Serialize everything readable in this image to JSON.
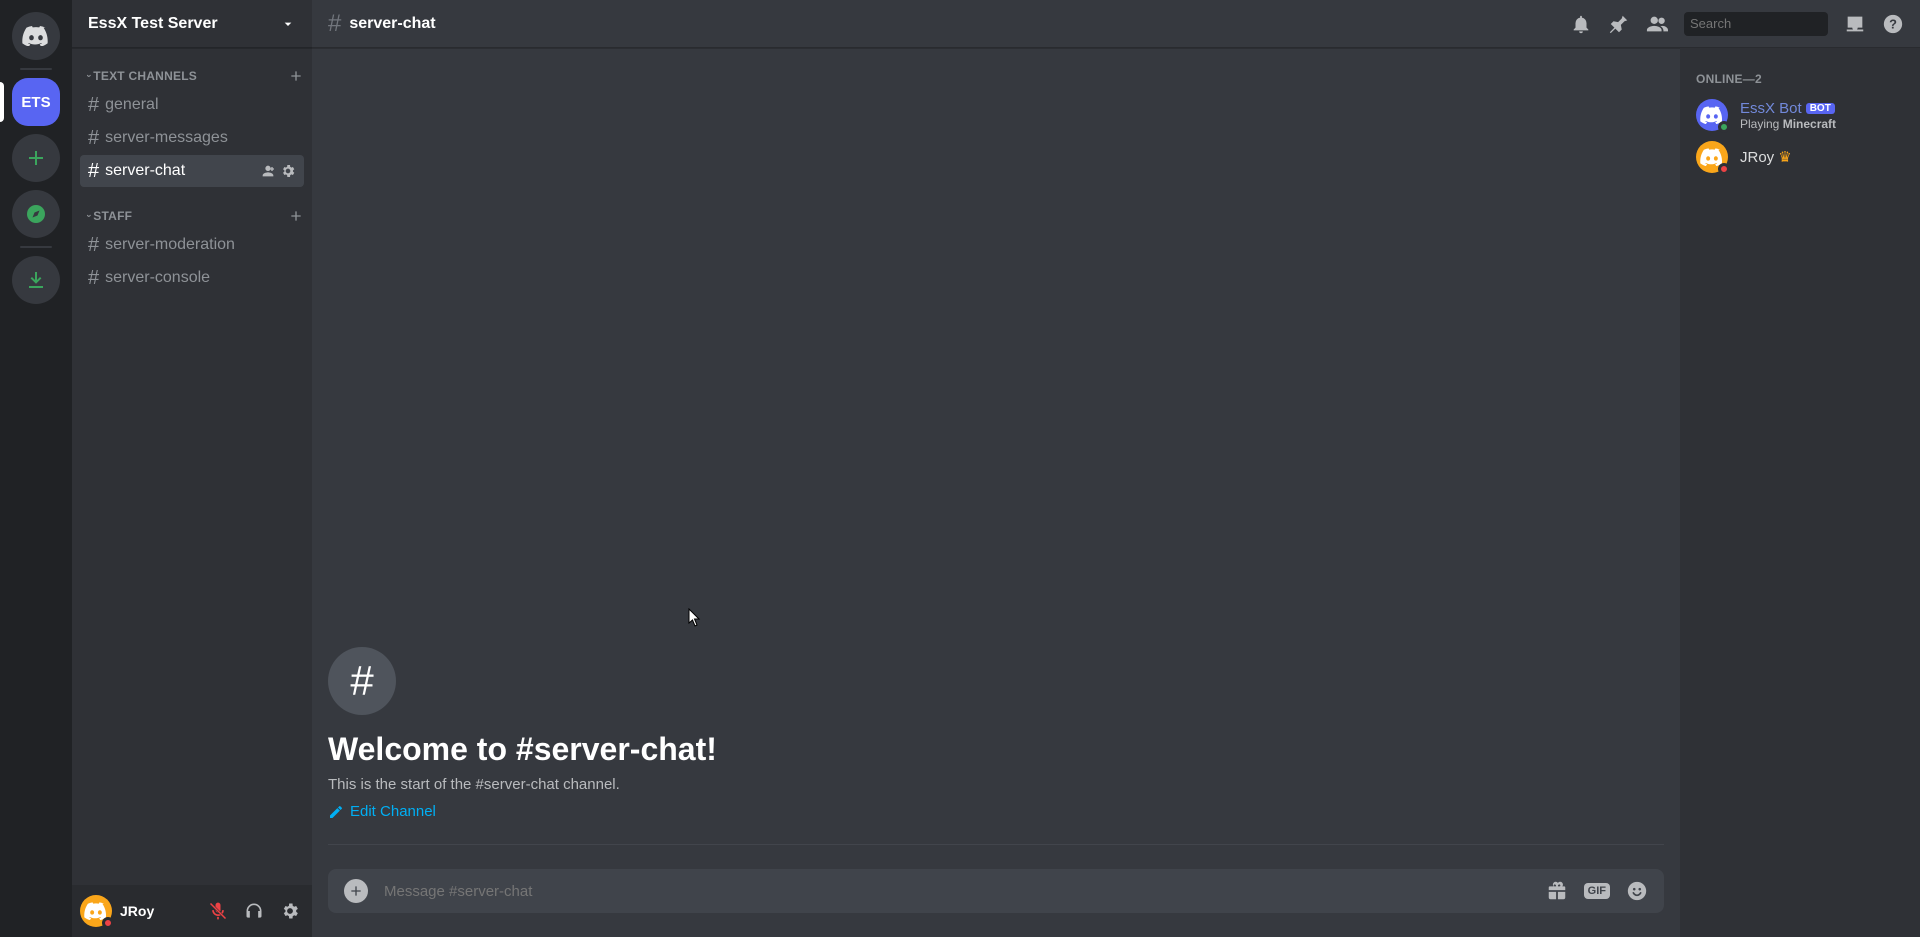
{
  "server": {
    "name": "EssX Test Server",
    "initials": "ETS"
  },
  "categories": [
    {
      "name": "TEXT CHANNELS",
      "channels": [
        {
          "name": "general",
          "active": false
        },
        {
          "name": "server-messages",
          "active": false
        },
        {
          "name": "server-chat",
          "active": true
        }
      ]
    },
    {
      "name": "STAFF",
      "channels": [
        {
          "name": "server-moderation",
          "active": false
        },
        {
          "name": "server-console",
          "active": false
        }
      ]
    }
  ],
  "self": {
    "name": "JRoy"
  },
  "header": {
    "channel": "server-chat",
    "search_placeholder": "Search"
  },
  "welcome": {
    "title": "Welcome to #server-chat!",
    "subtitle": "This is the start of the #server-chat channel.",
    "edit": "Edit Channel"
  },
  "compose": {
    "placeholder": "Message #server-chat",
    "gif": "GIF"
  },
  "members": {
    "heading": "ONLINE—2",
    "list": [
      {
        "name": "EssX Bot",
        "bot": true,
        "status": "online",
        "color": "#7289da",
        "activity_prefix": "Playing ",
        "activity_bold": "Minecraft",
        "avatar": "#5865f2"
      },
      {
        "name": "JRoy",
        "bot": false,
        "owner": true,
        "status": "dnd",
        "color": "#dcddde",
        "avatar": "#faa61a"
      }
    ]
  }
}
